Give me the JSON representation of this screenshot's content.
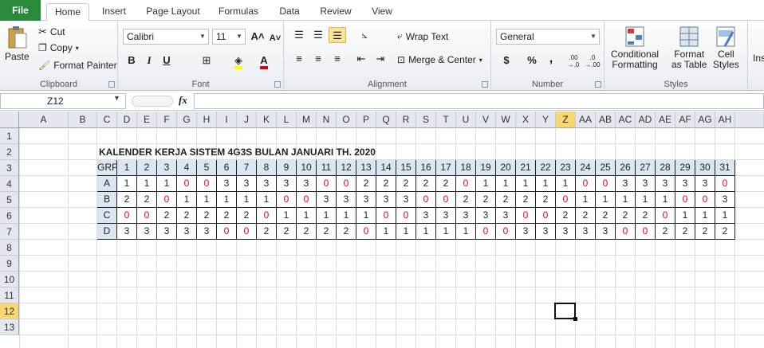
{
  "tabs": [
    "File",
    "Home",
    "Insert",
    "Page Layout",
    "Formulas",
    "Data",
    "Review",
    "View"
  ],
  "ribbon": {
    "clipboard": {
      "label": "Clipboard",
      "paste": "Paste",
      "cut": "Cut",
      "copy": "Copy",
      "format_painter": "Format Painter"
    },
    "font": {
      "label": "Font",
      "name": "Calibri",
      "size": "11",
      "bold": "B",
      "italic": "I",
      "underline": "U",
      "grow": "A",
      "shrink": "A"
    },
    "alignment": {
      "label": "Alignment",
      "wrap": "Wrap Text",
      "merge": "Merge & Center"
    },
    "number": {
      "label": "Number",
      "format": "General",
      "currency": "$",
      "percent": "%",
      "comma": ",",
      "inc": ".00 →.0",
      "dec": ".0 →.00"
    },
    "styles": {
      "label": "Styles",
      "cond1": "Conditional",
      "cond2": "Formatting",
      "ftab1": "Format",
      "ftab2": "as Table",
      "cell1": "Cell",
      "cell2": "Styles"
    },
    "insert_partial": "Ins"
  },
  "formula_bar": {
    "name_box": "Z12",
    "fx": "fx",
    "value": ""
  },
  "columns": [
    "A",
    "B",
    "C",
    "D",
    "E",
    "F",
    "G",
    "H",
    "I",
    "J",
    "K",
    "L",
    "M",
    "N",
    "O",
    "P",
    "Q",
    "R",
    "S",
    "T",
    "U",
    "V",
    "W",
    "X",
    "Y",
    "Z",
    "AA",
    "AB",
    "AC",
    "AD",
    "AE",
    "AF",
    "AG",
    "AH"
  ],
  "rows": [
    "1",
    "2",
    "3",
    "4",
    "5",
    "6",
    "7",
    "8",
    "9",
    "10",
    "11",
    "12",
    "13"
  ],
  "selected_cell": {
    "column": "Z",
    "row": "12"
  },
  "sheet": {
    "title": "KALENDER KERJA SISTEM 4G3S BULAN  JANUARI TH. 2020",
    "header": [
      "GRP",
      "1",
      "2",
      "3",
      "4",
      "5",
      "6",
      "7",
      "8",
      "9",
      "10",
      "11",
      "12",
      "13",
      "14",
      "15",
      "16",
      "17",
      "18",
      "19",
      "20",
      "21",
      "22",
      "23",
      "24",
      "25",
      "26",
      "27",
      "28",
      "29",
      "30",
      "31"
    ],
    "groups": [
      {
        "name": "A",
        "values": [
          "1",
          "1",
          "1",
          "0",
          "0",
          "3",
          "3",
          "3",
          "3",
          "3",
          "0",
          "0",
          "2",
          "2",
          "2",
          "2",
          "2",
          "0",
          "1",
          "1",
          "1",
          "1",
          "1",
          "0",
          "0",
          "3",
          "3",
          "3",
          "3",
          "3",
          "0"
        ]
      },
      {
        "name": "B",
        "values": [
          "2",
          "2",
          "0",
          "1",
          "1",
          "1",
          "1",
          "1",
          "0",
          "0",
          "3",
          "3",
          "3",
          "3",
          "3",
          "0",
          "0",
          "2",
          "2",
          "2",
          "2",
          "2",
          "0",
          "1",
          "1",
          "1",
          "1",
          "1",
          "0",
          "0",
          "3"
        ]
      },
      {
        "name": "C",
        "values": [
          "0",
          "0",
          "2",
          "2",
          "2",
          "2",
          "2",
          "0",
          "1",
          "1",
          "1",
          "1",
          "1",
          "0",
          "0",
          "3",
          "3",
          "3",
          "3",
          "3",
          "0",
          "0",
          "2",
          "2",
          "2",
          "2",
          "2",
          "0",
          "1",
          "1",
          "1"
        ]
      },
      {
        "name": "D",
        "values": [
          "3",
          "3",
          "3",
          "3",
          "3",
          "0",
          "0",
          "2",
          "2",
          "2",
          "2",
          "2",
          "0",
          "1",
          "1",
          "1",
          "1",
          "1",
          "0",
          "0",
          "3",
          "3",
          "3",
          "3",
          "3",
          "0",
          "0",
          "2",
          "2",
          "2",
          "2"
        ]
      }
    ],
    "off_color": "#e0001a"
  }
}
